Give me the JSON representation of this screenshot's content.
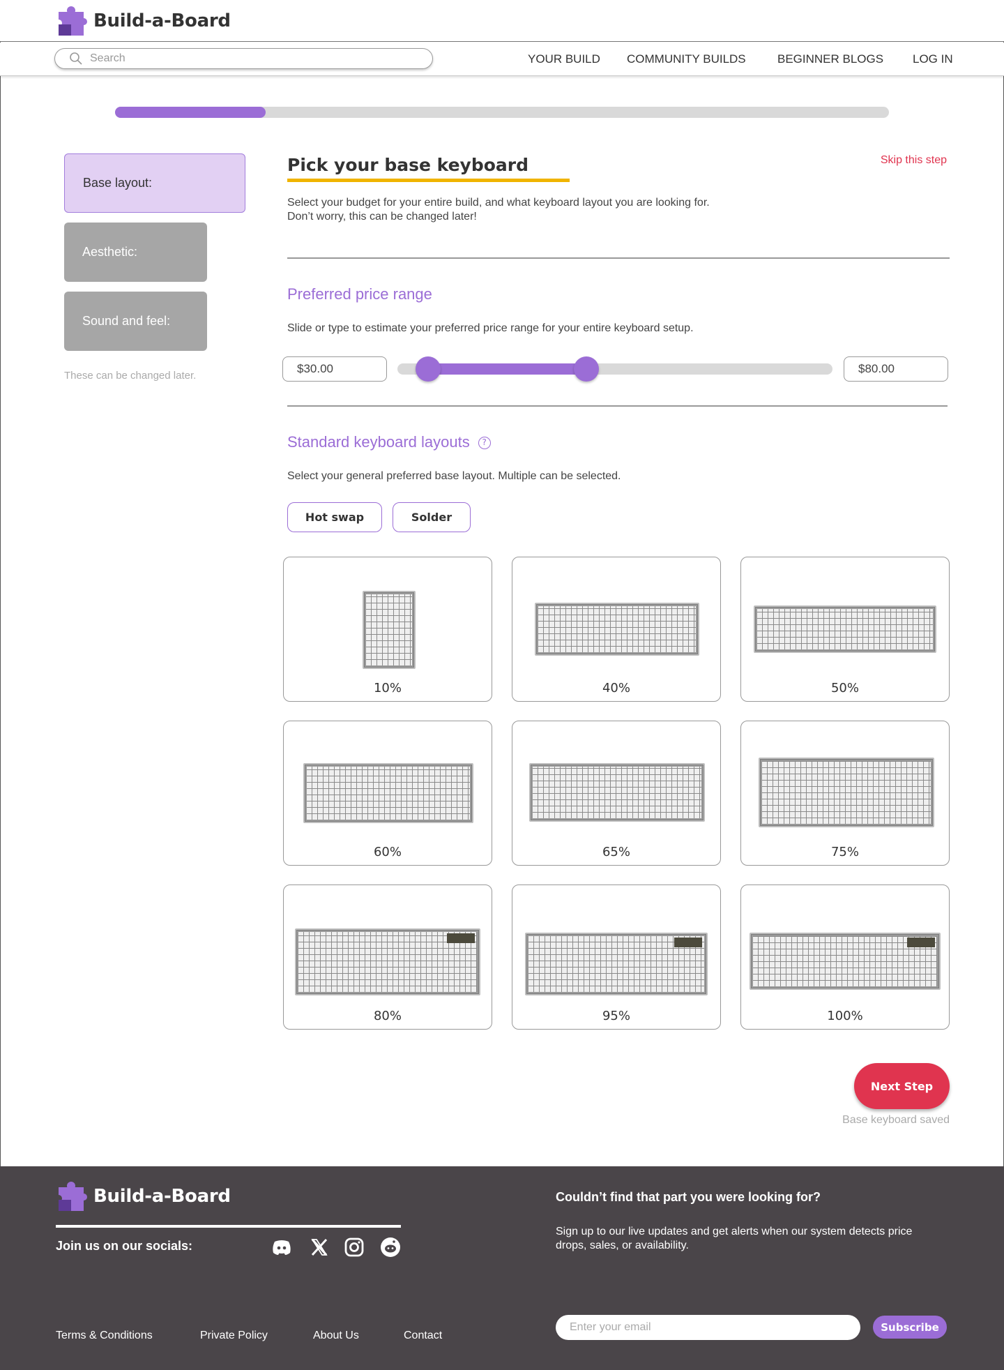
{
  "app": {
    "name": "Build-a-Board"
  },
  "search": {
    "placeholder": "Search"
  },
  "nav": {
    "your_build": "YOUR BUILD",
    "community_builds": "COMMUNITY BUILDS",
    "beginner_blogs": "BEGINNER BLOGS",
    "log_in": "LOG IN"
  },
  "progress": {
    "fraction": 0.195
  },
  "sidebar": {
    "steps": [
      {
        "label": "Base layout:",
        "active": true
      },
      {
        "label": "Aesthetic:",
        "active": false
      },
      {
        "label": "Sound and feel:",
        "active": false
      }
    ],
    "note": "These can be changed later."
  },
  "main": {
    "title": "Pick your base keyboard",
    "skip": "Skip this step",
    "description_line1": "Select your budget for your entire build, and what keyboard layout you are looking for.",
    "description_line2": "Don’t worry, this can be changed later!",
    "price": {
      "heading": "Preferred price range",
      "description": "Slide or type to estimate your preferred price range for your entire keyboard setup.",
      "min_value": "$30.00",
      "max_value": "$80.00",
      "min_fraction": 0.07,
      "max_fraction": 0.435
    },
    "layouts": {
      "heading": "Standard keyboard layouts",
      "help_icon": "question-circle-icon",
      "description": "Select your general preferred base layout. Multiple can be selected.",
      "toggles": [
        "Hot swap",
        "Solder"
      ],
      "cards": [
        "10%",
        "40%",
        "50%",
        "60%",
        "65%",
        "75%",
        "80%",
        "95%",
        "100%"
      ]
    },
    "next_button": "Next Step",
    "saved_note": "Base keyboard saved"
  },
  "footer": {
    "brand": "Build-a-Board",
    "socials_label": "Join us on our socials:",
    "socials": [
      "discord-icon",
      "x-icon",
      "instagram-icon",
      "reddit-icon"
    ],
    "heading": "Couldn’t find that part you were looking for?",
    "text": "Sign up to our live updates and get alerts when our system detects price drops, sales, or availability.",
    "links": [
      "Terms & Conditions",
      "Private Policy",
      "About Us",
      "Contact"
    ],
    "email_placeholder": "Enter your email",
    "subscribe": "Subscribe"
  },
  "colors": {
    "accent": "#9b6dd6",
    "accent_light": "#e2d0f3",
    "cta": "#e0344f",
    "underline": "#f0b400",
    "footer_bg": "#4a4549"
  }
}
